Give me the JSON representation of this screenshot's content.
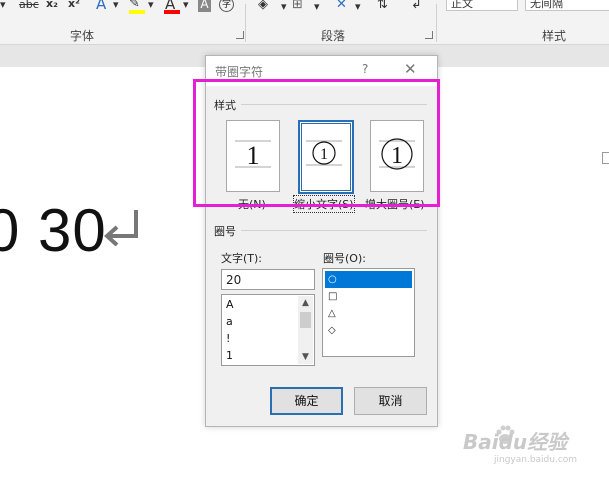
{
  "ribbon": {
    "groups": {
      "font": "字体",
      "paragraph": "段落",
      "styles": "样式"
    },
    "style_gallery": {
      "normal": "正文",
      "no_spacing": "无间隔"
    },
    "font_tools": {
      "strikethrough": "abc",
      "subscript": "x₂",
      "superscript": "x²"
    },
    "highlight_color": "#ffff00",
    "font_color": "#ff0000"
  },
  "document": {
    "text": "0 30"
  },
  "dialog": {
    "title": "带圈字符",
    "help": "?",
    "close": "✕",
    "style_section": "样式",
    "styles": [
      {
        "label": "无(N)",
        "glyph": "1",
        "selected": false
      },
      {
        "label": "缩小文字(S)",
        "glyph": "①",
        "selected": true
      },
      {
        "label": "增大圈号(E)",
        "glyph": "①",
        "selected": false
      }
    ],
    "enclosure_section": "圈号",
    "text_label": "文字(T):",
    "text_value": "20",
    "text_list": [
      "A",
      "a",
      "!",
      "1"
    ],
    "enclosure_label": "圈号(O):",
    "enclosure_list": [
      "○",
      "□",
      "△",
      "◇"
    ],
    "enclosure_selected": 0,
    "ok": "确定",
    "cancel": "取消"
  },
  "annotation_color": "#e61fd4",
  "watermark": {
    "brand": "Baidu经验",
    "url": "jingyan.baidu.com"
  }
}
